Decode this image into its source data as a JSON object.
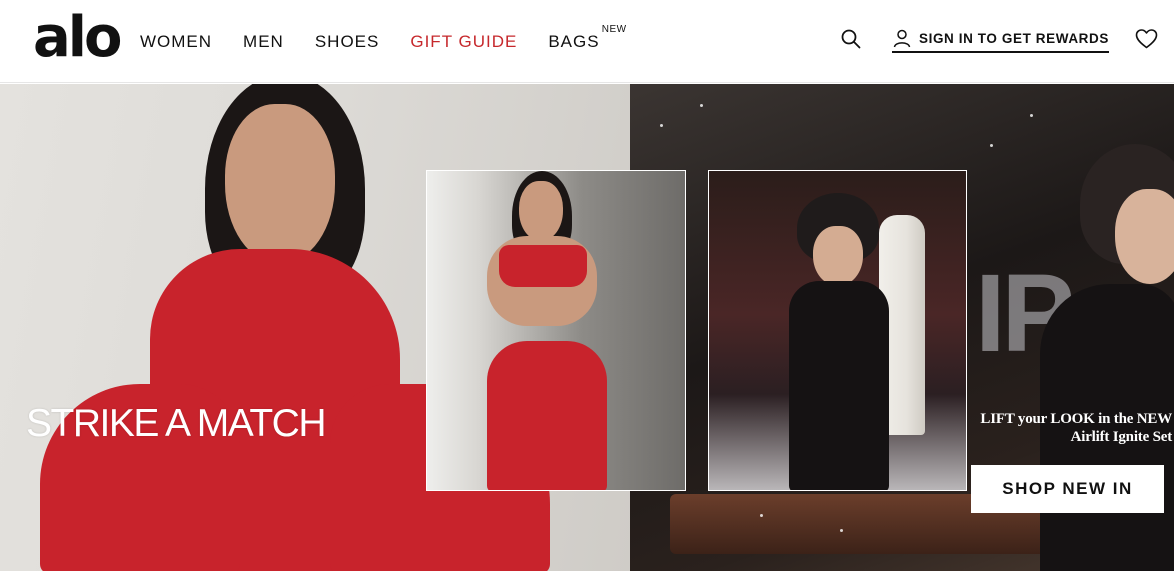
{
  "header": {
    "logo": "alo",
    "nav": [
      {
        "label": "WOMEN"
      },
      {
        "label": "MEN"
      },
      {
        "label": "SHOES"
      },
      {
        "label": "GIFT GUIDE"
      },
      {
        "label": "BAGS",
        "badge": "NEW"
      }
    ],
    "signin_label": "SIGN IN TO GET REWARDS",
    "icons": {
      "search": "search-icon",
      "account": "user-icon",
      "wishlist": "heart-icon"
    },
    "accent_color": "#c6282c"
  },
  "hero": {
    "headline": "STRIKE A MATCH",
    "subheadline_line1": "LIFT your LOOK in the NEW",
    "subheadline_line2": "Airlift Ignite Set",
    "cta_label": "SHOP NEW IN"
  }
}
